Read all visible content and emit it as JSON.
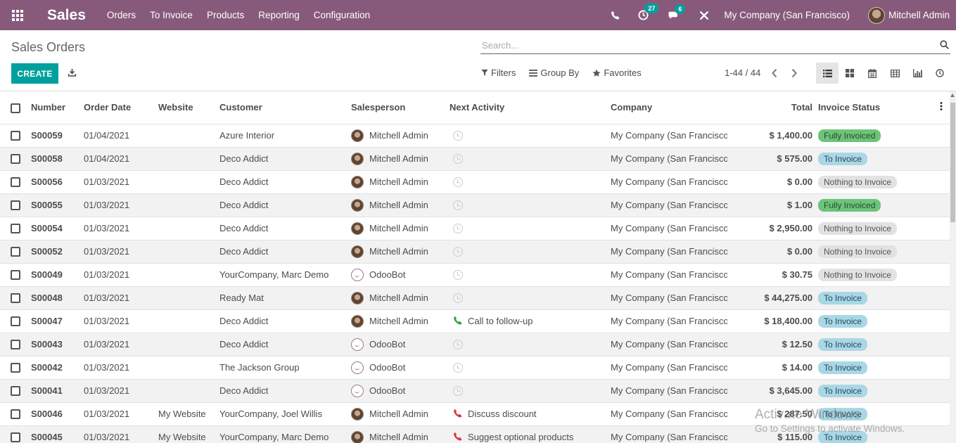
{
  "navbar": {
    "brand": "Sales",
    "menu": [
      "Orders",
      "To Invoice",
      "Products",
      "Reporting",
      "Configuration"
    ],
    "messages_badge": "27",
    "chat_badge": "6",
    "company": "My Company (San Francisco)",
    "user": "Mitchell Admin"
  },
  "control": {
    "title": "Sales Orders",
    "search_placeholder": "Search...",
    "create_label": "CREATE",
    "filters_label": "Filters",
    "groupby_label": "Group By",
    "favorites_label": "Favorites",
    "pager": "1-44 / 44"
  },
  "table": {
    "headers": {
      "number": "Number",
      "order_date": "Order Date",
      "website": "Website",
      "customer": "Customer",
      "salesperson": "Salesperson",
      "next_activity": "Next Activity",
      "company": "Company",
      "total": "Total",
      "invoice_status": "Invoice Status"
    },
    "rows": [
      {
        "number": "S00059",
        "date": "01/04/2021",
        "website": "",
        "customer": "Azure Interior",
        "salesperson": "Mitchell Admin",
        "avatar": "admin",
        "activity": "",
        "activity_icon": "clock",
        "company": "My Company (San Francisco)",
        "total": "$ 1,400.00",
        "status": "Fully Invoiced",
        "status_kind": "fully"
      },
      {
        "number": "S00058",
        "date": "01/04/2021",
        "website": "",
        "customer": "Deco Addict",
        "salesperson": "Mitchell Admin",
        "avatar": "admin",
        "activity": "",
        "activity_icon": "clock",
        "company": "My Company (San Francisco)",
        "total": "$ 575.00",
        "status": "To Invoice",
        "status_kind": "to"
      },
      {
        "number": "S00056",
        "date": "01/03/2021",
        "website": "",
        "customer": "Deco Addict",
        "salesperson": "Mitchell Admin",
        "avatar": "admin",
        "activity": "",
        "activity_icon": "clock",
        "company": "My Company (San Francisco)",
        "total": "$ 0.00",
        "status": "Nothing to Invoice",
        "status_kind": "nothing"
      },
      {
        "number": "S00055",
        "date": "01/03/2021",
        "website": "",
        "customer": "Deco Addict",
        "salesperson": "Mitchell Admin",
        "avatar": "admin",
        "activity": "",
        "activity_icon": "clock",
        "company": "My Company (San Francisco)",
        "total": "$ 1.00",
        "status": "Fully Invoiced",
        "status_kind": "fully"
      },
      {
        "number": "S00054",
        "date": "01/03/2021",
        "website": "",
        "customer": "Deco Addict",
        "salesperson": "Mitchell Admin",
        "avatar": "admin",
        "activity": "",
        "activity_icon": "clock",
        "company": "My Company (San Francisco)",
        "total": "$ 2,950.00",
        "status": "Nothing to Invoice",
        "status_kind": "nothing"
      },
      {
        "number": "S00052",
        "date": "01/03/2021",
        "website": "",
        "customer": "Deco Addict",
        "salesperson": "Mitchell Admin",
        "avatar": "admin",
        "activity": "",
        "activity_icon": "clock",
        "company": "My Company (San Francisco)",
        "total": "$ 0.00",
        "status": "Nothing to Invoice",
        "status_kind": "nothing"
      },
      {
        "number": "S00049",
        "date": "01/03/2021",
        "website": "",
        "customer": "YourCompany, Marc Demo",
        "salesperson": "OdooBot",
        "avatar": "bot",
        "activity": "",
        "activity_icon": "clock",
        "company": "My Company (San Francisco)",
        "total": "$ 30.75",
        "status": "Nothing to Invoice",
        "status_kind": "nothing"
      },
      {
        "number": "S00048",
        "date": "01/03/2021",
        "website": "",
        "customer": "Ready Mat",
        "salesperson": "Mitchell Admin",
        "avatar": "admin",
        "activity": "",
        "activity_icon": "clock",
        "company": "My Company (San Francisco)",
        "total": "$ 44,275.00",
        "status": "To Invoice",
        "status_kind": "to"
      },
      {
        "number": "S00047",
        "date": "01/03/2021",
        "website": "",
        "customer": "Deco Addict",
        "salesperson": "Mitchell Admin",
        "avatar": "admin",
        "activity": "Call to follow-up",
        "activity_icon": "phone-green",
        "company": "My Company (San Francisco)",
        "total": "$ 18,400.00",
        "status": "To Invoice",
        "status_kind": "to"
      },
      {
        "number": "S00043",
        "date": "01/03/2021",
        "website": "",
        "customer": "Deco Addict",
        "salesperson": "OdooBot",
        "avatar": "bot",
        "activity": "",
        "activity_icon": "clock",
        "company": "My Company (San Francisco)",
        "total": "$ 12.50",
        "status": "To Invoice",
        "status_kind": "to"
      },
      {
        "number": "S00042",
        "date": "01/03/2021",
        "website": "",
        "customer": "The Jackson Group",
        "salesperson": "OdooBot",
        "avatar": "bot",
        "activity": "",
        "activity_icon": "clock",
        "company": "My Company (San Francisco)",
        "total": "$ 14.00",
        "status": "To Invoice",
        "status_kind": "to"
      },
      {
        "number": "S00041",
        "date": "01/03/2021",
        "website": "",
        "customer": "Deco Addict",
        "salesperson": "OdooBot",
        "avatar": "bot",
        "activity": "",
        "activity_icon": "clock",
        "company": "My Company (San Francisco)",
        "total": "$ 3,645.00",
        "status": "To Invoice",
        "status_kind": "to"
      },
      {
        "number": "S00046",
        "date": "01/03/2021",
        "website": "My Website",
        "customer": "YourCompany, Joel Willis",
        "salesperson": "Mitchell Admin",
        "avatar": "admin",
        "activity": "Discuss discount",
        "activity_icon": "phone-red",
        "company": "My Company (San Francisco)",
        "total": "$ 287.50",
        "status": "To Invoice",
        "status_kind": "to"
      },
      {
        "number": "S00045",
        "date": "01/03/2021",
        "website": "My Website",
        "customer": "YourCompany, Marc Demo",
        "salesperson": "Mitchell Admin",
        "avatar": "admin",
        "activity": "Suggest optional products",
        "activity_icon": "phone-red",
        "company": "My Company (San Francisco)",
        "total": "$ 115.00",
        "status": "To Invoice",
        "status_kind": "to"
      }
    ]
  },
  "watermark": {
    "line1": "Activate Windows",
    "line2": "Go to Settings to activate Windows."
  },
  "colors": {
    "navbar": "#875a7b",
    "primary": "#00a09d",
    "fully_invoiced": "#6cc47a",
    "to_invoice": "#a9d7e5",
    "nothing_to_invoice": "#e2e2e2",
    "phone_green": "#28a745",
    "phone_red": "#dc3545"
  }
}
